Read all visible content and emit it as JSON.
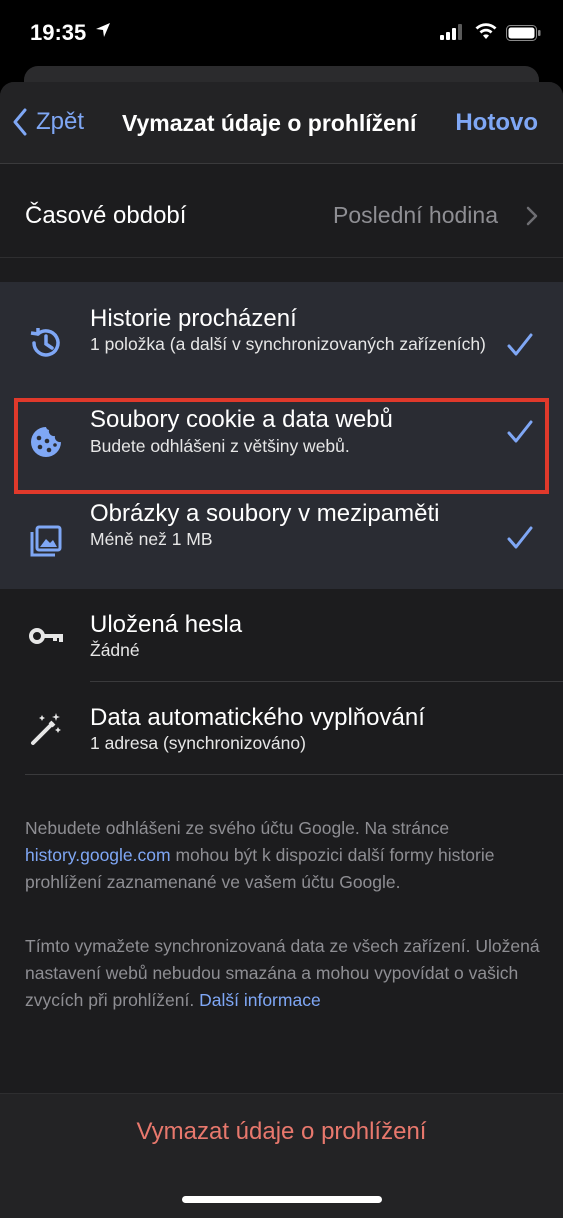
{
  "status_bar": {
    "time": "19:35"
  },
  "nav": {
    "back_label": "Zpět",
    "title": "Vymazat údaje o prohlížení",
    "done_label": "Hotovo"
  },
  "time_range": {
    "label": "Časové období",
    "value": "Poslední hodina"
  },
  "items": [
    {
      "title": "Historie procházení",
      "subtitle": "1 položka (a další v synchronizovaných zařízeních)",
      "icon": "history-icon",
      "checked": true
    },
    {
      "title": "Soubory cookie a data webů",
      "subtitle": "Budete odhlášeni z většiny webů.",
      "icon": "cookie-icon",
      "checked": true
    },
    {
      "title": "Obrázky a soubory v mezipaměti",
      "subtitle": "Méně než 1 MB",
      "icon": "images-icon",
      "checked": true
    },
    {
      "title": "Uložená hesla",
      "subtitle": "Žádné",
      "icon": "key-icon",
      "checked": false
    },
    {
      "title": "Data automatického vyplňování",
      "subtitle": "1 adresa (synchronizováno)",
      "icon": "magic-wand-icon",
      "checked": false
    }
  ],
  "footer": {
    "note1_pre": "Nebudete odhlášeni ze svého účtu Google. Na stránce",
    "note1_link": "history.google.com",
    "note1_post": " mohou být k dispozici další formy historie prohlížení zaznamenané ve vašem účtu Google.",
    "note2_pre": "Tímto vymažete synchronizovaná data ze všech zařízení. Uložená nastavení webů nebudou smazána a mohou vypovídat o vašich zvycích při prohlížení. ",
    "note2_link": "Další informace"
  },
  "action": {
    "clear_label": "Vymazat údaje o prohlížení"
  },
  "colors": {
    "accent": "#7fa7f5",
    "destructive": "#e8786d",
    "highlight": "#e0392b"
  }
}
